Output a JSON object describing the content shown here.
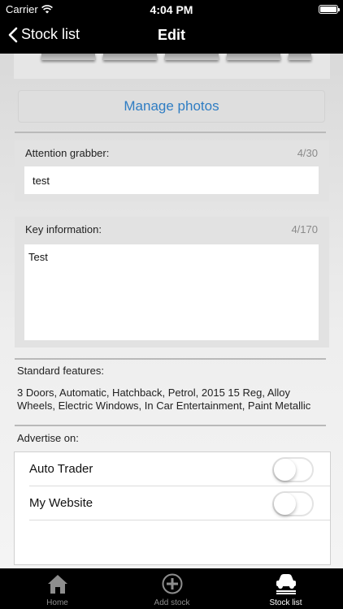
{
  "status_bar": {
    "carrier": "Carrier",
    "time": "4:04 PM"
  },
  "nav_bar": {
    "back_label": "Stock list",
    "title": "Edit"
  },
  "photos": {
    "manage_label": "Manage photos"
  },
  "attention_grabber": {
    "label": "Attention grabber:",
    "count": "4/30",
    "value": "test"
  },
  "key_information": {
    "label": "Key information:",
    "count": "4/170",
    "value": "Test"
  },
  "standard_features": {
    "label": "Standard features:",
    "text": "3 Doors, Automatic, Hatchback, Petrol, 2015 15 Reg, Alloy Wheels, Electric Windows, In Car Entertainment, Paint Metallic"
  },
  "advertise": {
    "label": "Advertise on:",
    "options": [
      {
        "label": "Auto Trader",
        "enabled": false
      },
      {
        "label": "My Website",
        "enabled": false
      }
    ]
  },
  "tab_bar": {
    "tabs": [
      {
        "label": "Home",
        "icon": "home-icon",
        "active": false
      },
      {
        "label": "Add stock",
        "icon": "add-circle-icon",
        "active": false
      },
      {
        "label": "Stock list",
        "icon": "car-list-icon",
        "active": true
      }
    ]
  },
  "colors": {
    "accent": "#2f7dc3",
    "bar_background": "#000000",
    "inactive_tab": "#8d8d8d"
  }
}
